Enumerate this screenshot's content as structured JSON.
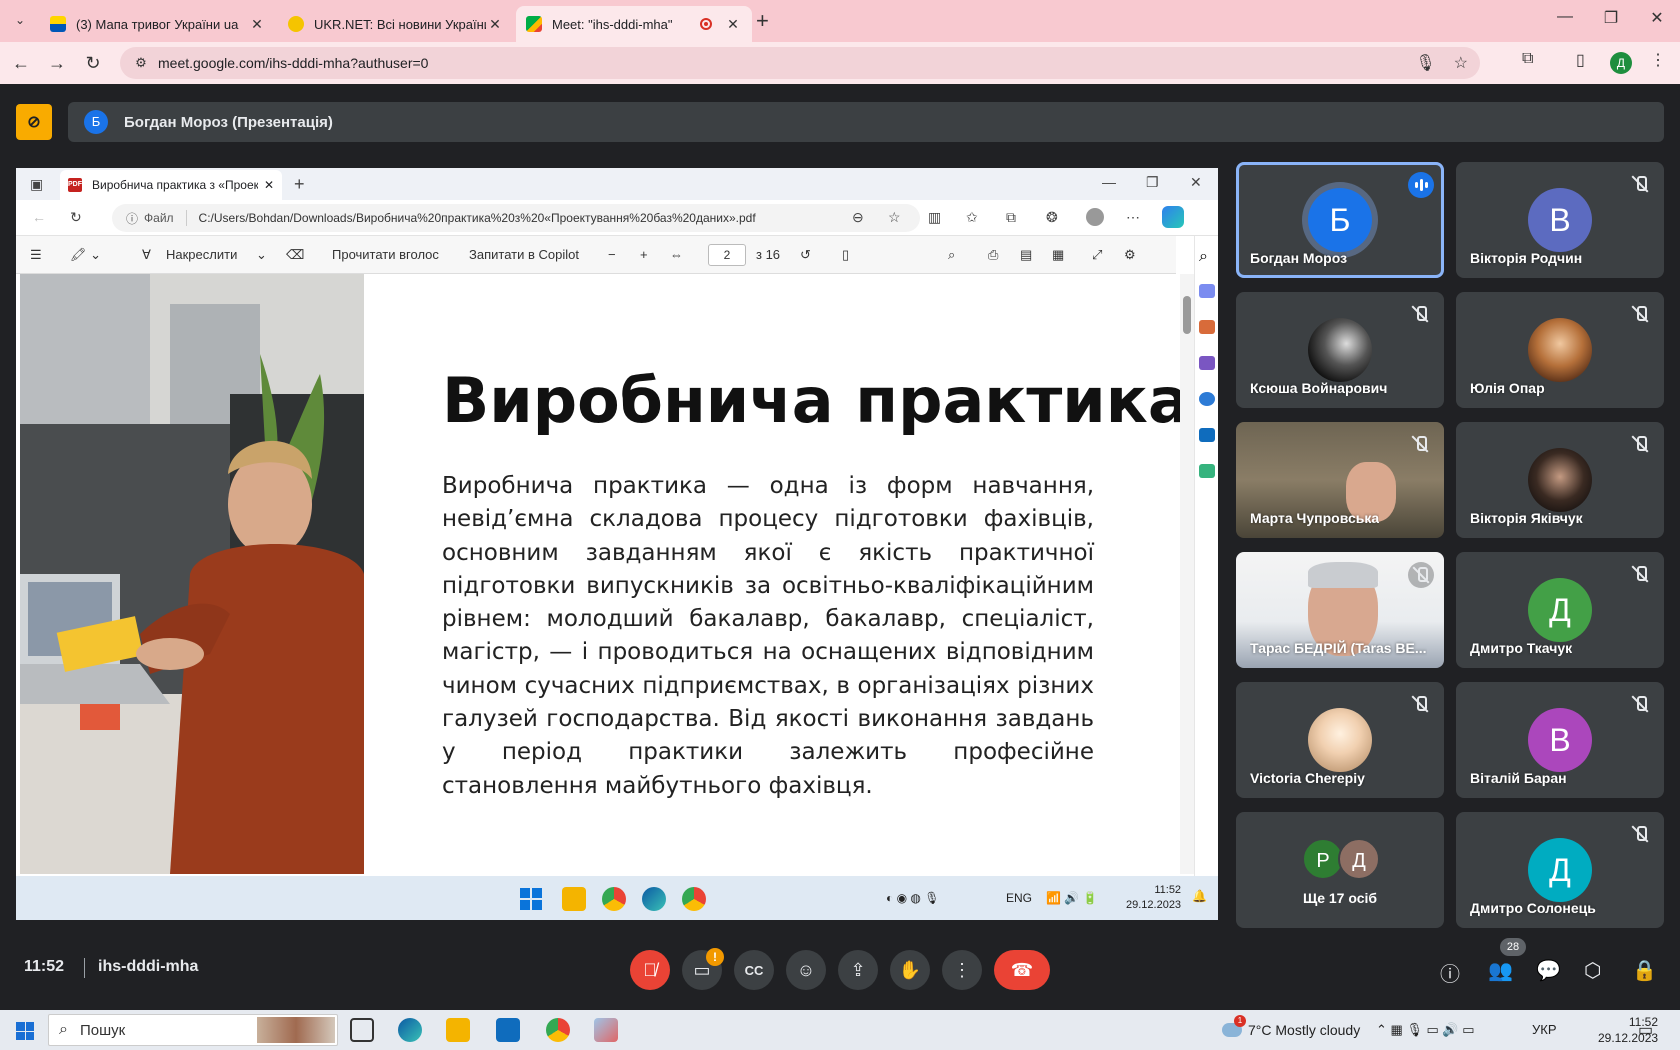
{
  "browser": {
    "tabs": [
      {
        "title": "(3) Мапа тривог України ua",
        "active": false
      },
      {
        "title": "UKR.NET: Всі новини України, ...",
        "active": false
      },
      {
        "title": "Meet: \"ihs-dddi-mha\"",
        "active": true
      }
    ],
    "url": "meet.google.com/ihs-dddi-mha?authuser=0",
    "profile_initial": "Д"
  },
  "meet": {
    "presenter_initial": "Б",
    "presenter_label": "Богдан Мороз (Презентація)",
    "time": "11:52",
    "meeting_code": "ihs-dddi-mha",
    "participant_count": "28",
    "participants": [
      {
        "name": "Богдан Мороз",
        "initial": "Б",
        "color": "#1a73e8",
        "speaking": true
      },
      {
        "name": "Вікторія Родчин",
        "initial": "В",
        "color": "#5c6bc0"
      },
      {
        "name": "Ксюша Войнарович",
        "initial": ""
      },
      {
        "name": "Юлія Опар",
        "initial": ""
      },
      {
        "name": "Марта Чупровська",
        "initial": ""
      },
      {
        "name": "Вікторія Яківчук",
        "initial": ""
      },
      {
        "name": "Тарас БЕДРІЙ (Taras BE...",
        "initial": ""
      },
      {
        "name": "Дмитро Ткачук",
        "initial": "Д",
        "color": "#43a047"
      },
      {
        "name": "Victoria Chereріу",
        "initial": ""
      },
      {
        "name": "Віталій Баран",
        "initial": "В",
        "color": "#ab47bc"
      },
      {
        "name": "Дмитро Солонець",
        "initial": "Д",
        "color": "#00acc1"
      }
    ],
    "more": {
      "label": "Ще 17 осіб",
      "initials": [
        "Р",
        "Д"
      ]
    }
  },
  "shared_screen": {
    "tab_title": "Виробнича практика з «Проект...",
    "file_label": "Файл",
    "path": "C:/Users/Bohdan/Downloads/Виробнича%20практика%20з%20«Проектування%20баз%20даних».pdf",
    "toolbar": {
      "draw": "Накреслити",
      "read_aloud": "Прочитати вголос",
      "copilot": "Запитати в Copilot",
      "page": "2",
      "of_pages": "з 16"
    },
    "slide": {
      "title": "Виробнича практика",
      "body": "Виробнича практика — одна із форм навчання, невід’ємна складова процесу підготовки фахівців, основним завданням якої є якість практичної підготовки випускників за освітньо-кваліфікаційним рівнем: молодший бакалавр, бакалавр, спеціаліст, магістр, — і проводиться на оснащених відповідним чином сучасних підприємствах, в організаціях різних галузей господарства. Від якості виконання завдань у період практики залежить професійне становлення майбутнього фахівця."
    },
    "taskbar": {
      "lang": "ENG",
      "time": "11:52",
      "date": "29.12.2023"
    }
  },
  "taskbar": {
    "search_placeholder": "Пошук",
    "weather": "7°C  Mostly cloudy",
    "weather_badge": "1",
    "lang": "УКР",
    "time": "11:52",
    "date": "29.12.2023"
  }
}
